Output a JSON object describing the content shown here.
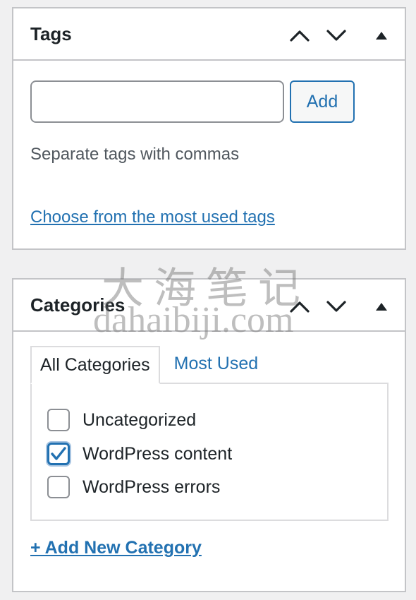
{
  "tags": {
    "title": "Tags",
    "input_value": "",
    "input_placeholder": "",
    "add_label": "Add",
    "hint": "Separate tags with commas",
    "most_used_link": "Choose from the most used tags"
  },
  "categories": {
    "title": "Categories",
    "tabs": [
      {
        "label": "All Categories",
        "active": true
      },
      {
        "label": "Most Used",
        "active": false
      }
    ],
    "items": [
      {
        "label": "Uncategorized",
        "checked": false
      },
      {
        "label": "WordPress content",
        "checked": true
      },
      {
        "label": "WordPress errors",
        "checked": false
      }
    ],
    "add_new_link": "+ Add New Category"
  },
  "watermark": {
    "chinese": "大海笔记",
    "domain": "dahaibiji.com"
  },
  "icons": {
    "move_up": "chevron-up-icon",
    "move_down": "chevron-down-icon",
    "toggle": "triangle-up-icon",
    "check": "checkmark-icon"
  },
  "colors": {
    "accent": "#2271b1",
    "text": "#1d2327",
    "muted_text": "#50575e",
    "border": "#c3c4c7",
    "page_bg": "#f0f0f1"
  }
}
